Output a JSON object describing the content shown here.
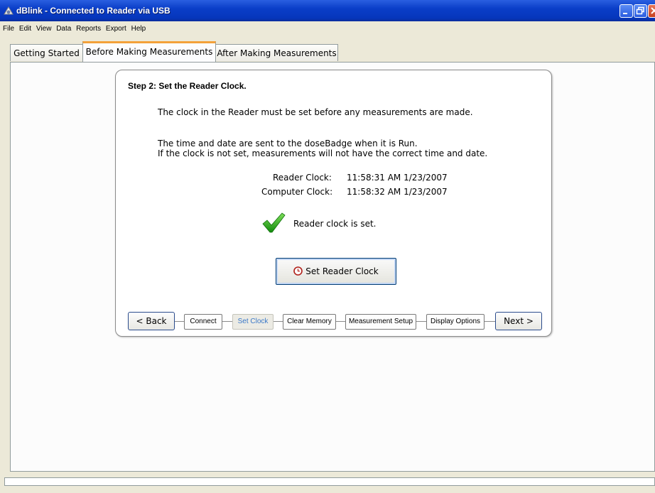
{
  "window": {
    "title": "dBlink - Connected to Reader via USB",
    "titlebar_color": "#0a3ec8"
  },
  "menu": [
    "File",
    "Edit",
    "View",
    "Data",
    "Reports",
    "Export",
    "Help"
  ],
  "tabs": [
    {
      "label": "Getting Started",
      "active": false
    },
    {
      "label": "Before Making Measurements",
      "active": true
    },
    {
      "label": "After Making Measurements",
      "active": false
    }
  ],
  "step": {
    "title": "Step 2: Set the Reader Clock.",
    "intro": "The clock in the Reader must be set before any measurements are made.",
    "info_line1": "The time and date are sent to the doseBadge when it is Run.",
    "info_line2": "If the clock is not set, measurements will not have the correct time and date.",
    "reader_clock_label": "Reader Clock:",
    "reader_clock_value": "11:58:31 AM 1/23/2007",
    "computer_clock_label": "Computer Clock:",
    "computer_clock_value": "11:58:32 AM 1/23/2007",
    "status_icon": "green-checkmark-icon",
    "status_text": "Reader clock is set.",
    "set_button_label": "Set Reader Clock",
    "set_button_icon": "clock-icon"
  },
  "wizard": {
    "back_label": "< Back",
    "next_label": "Next >",
    "steps": [
      {
        "label": "Connect",
        "current": false
      },
      {
        "label": "Set Clock",
        "current": true
      },
      {
        "label": "Clear Memory",
        "current": false
      },
      {
        "label": "Measurement Setup",
        "current": false
      },
      {
        "label": "Display Options",
        "current": false
      }
    ]
  },
  "colors": {
    "active_tab_accent": "#f3a13a",
    "current_step_text": "#3a78c8",
    "check_green": "#2fb21a"
  }
}
